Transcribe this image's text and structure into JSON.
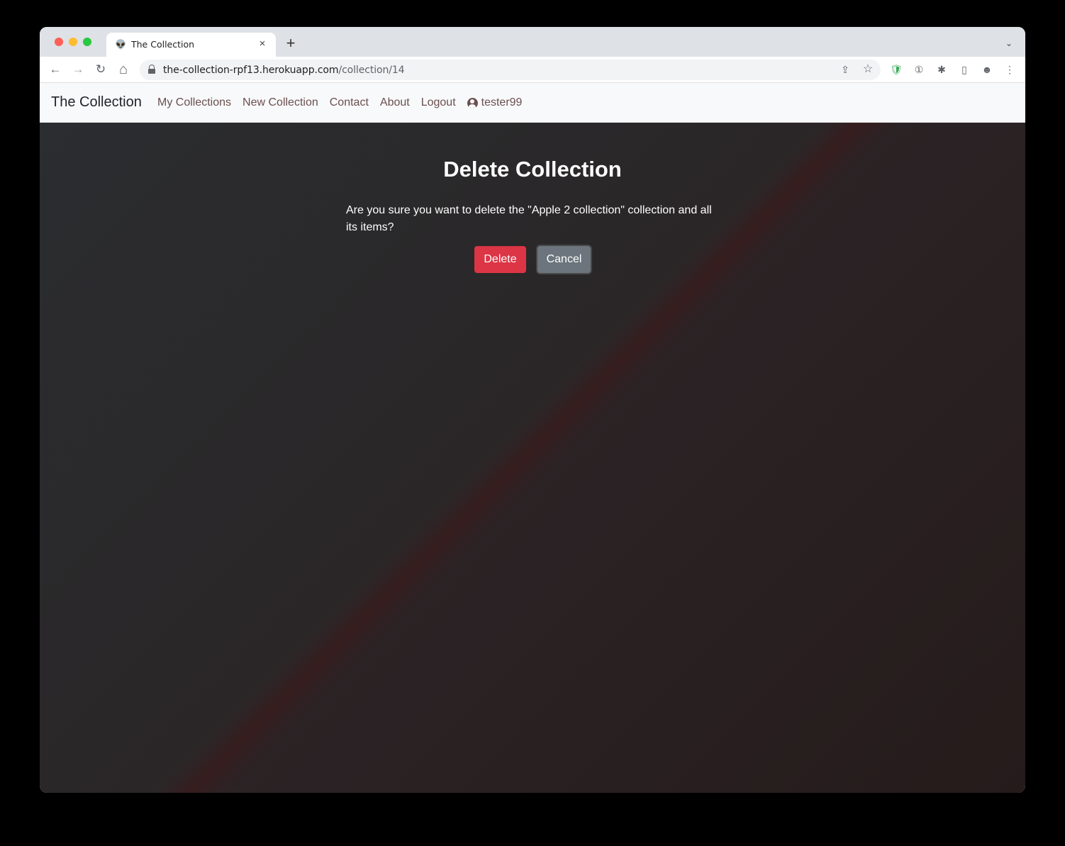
{
  "browser": {
    "tab_title": "The Collection",
    "tab_favicon": "👽",
    "url_host": "the-collection-rpf13.herokuapp.com",
    "url_path": "/collection/14",
    "icons": {
      "back": "←",
      "forward": "→",
      "reload": "↻",
      "home": "⌂",
      "share": "⇪",
      "bookmark": "☆",
      "extension_shield": "🛡",
      "extension_password": "①",
      "extensions_puzzle": "✱",
      "side_panel": "▯",
      "profile": "☻",
      "menu": "⋮",
      "new_tab": "+",
      "close_tab": "×",
      "tab_search": "⌄"
    }
  },
  "navbar": {
    "brand": "The Collection",
    "links": [
      "My Collections",
      "New Collection",
      "Contact",
      "About",
      "Logout"
    ],
    "username": "tester99"
  },
  "main": {
    "heading": "Delete Collection",
    "message": "Are you sure you want to delete the \"Apple 2 collection\" collection and all its items?",
    "delete_label": "Delete",
    "cancel_label": "Cancel"
  },
  "colors": {
    "delete_button": "#dc3545",
    "cancel_button": "#6c757d",
    "nav_link": "#6b4f4f"
  }
}
